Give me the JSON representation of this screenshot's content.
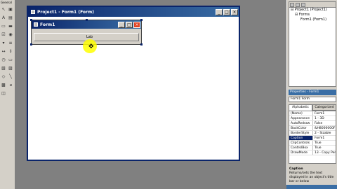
{
  "toolbox": {
    "title": "General",
    "tools": [
      "pointer-icon",
      "picturebox-icon",
      "label-icon",
      "textbox-icon",
      "frame-icon",
      "commandbutton-icon",
      "checkbox-icon",
      "optionbutton-icon",
      "combobox-icon",
      "listbox-icon",
      "hscroll-icon",
      "vscroll-icon",
      "timer-icon",
      "drivelist-icon",
      "dirlist-icon",
      "filelist-icon",
      "shape-icon",
      "line-icon",
      "image-icon",
      "data-icon",
      "ole-icon"
    ]
  },
  "designer": {
    "title": "Project1 - Form1 (Form)",
    "form": {
      "title": "Form1",
      "label_text": "Lab"
    }
  },
  "project_explorer": {
    "tree": [
      "Project1 (Project1)",
      "Forms",
      "Form1 (Form1)"
    ]
  },
  "properties": {
    "title": "Properties - Form1",
    "object": "Form1  Form",
    "tabs": [
      "Alphabetic",
      "Categorized"
    ],
    "rows": [
      {
        "k": "(Name)",
        "v": "Form1"
      },
      {
        "k": "Appearance",
        "v": "1 - 3D"
      },
      {
        "k": "AutoRedraw",
        "v": "False"
      },
      {
        "k": "BackColor",
        "v": "&H8000000F"
      },
      {
        "k": "BorderStyle",
        "v": "2 - Sizable"
      },
      {
        "k": "Caption",
        "v": "Form1"
      },
      {
        "k": "ClipControls",
        "v": "True"
      },
      {
        "k": "ControlBox",
        "v": "True"
      },
      {
        "k": "DrawMode",
        "v": "13 - Copy Pen"
      }
    ],
    "selected_row": "Caption",
    "desc_title": "Caption",
    "desc_text": "Returns/sets the text displayed in an object's title bar or below"
  },
  "colors": {
    "title_active": "#0a246a",
    "title_gradient_end": "#3a6ea5",
    "face": "#d4d0c8",
    "highlight": "#ffff00"
  }
}
